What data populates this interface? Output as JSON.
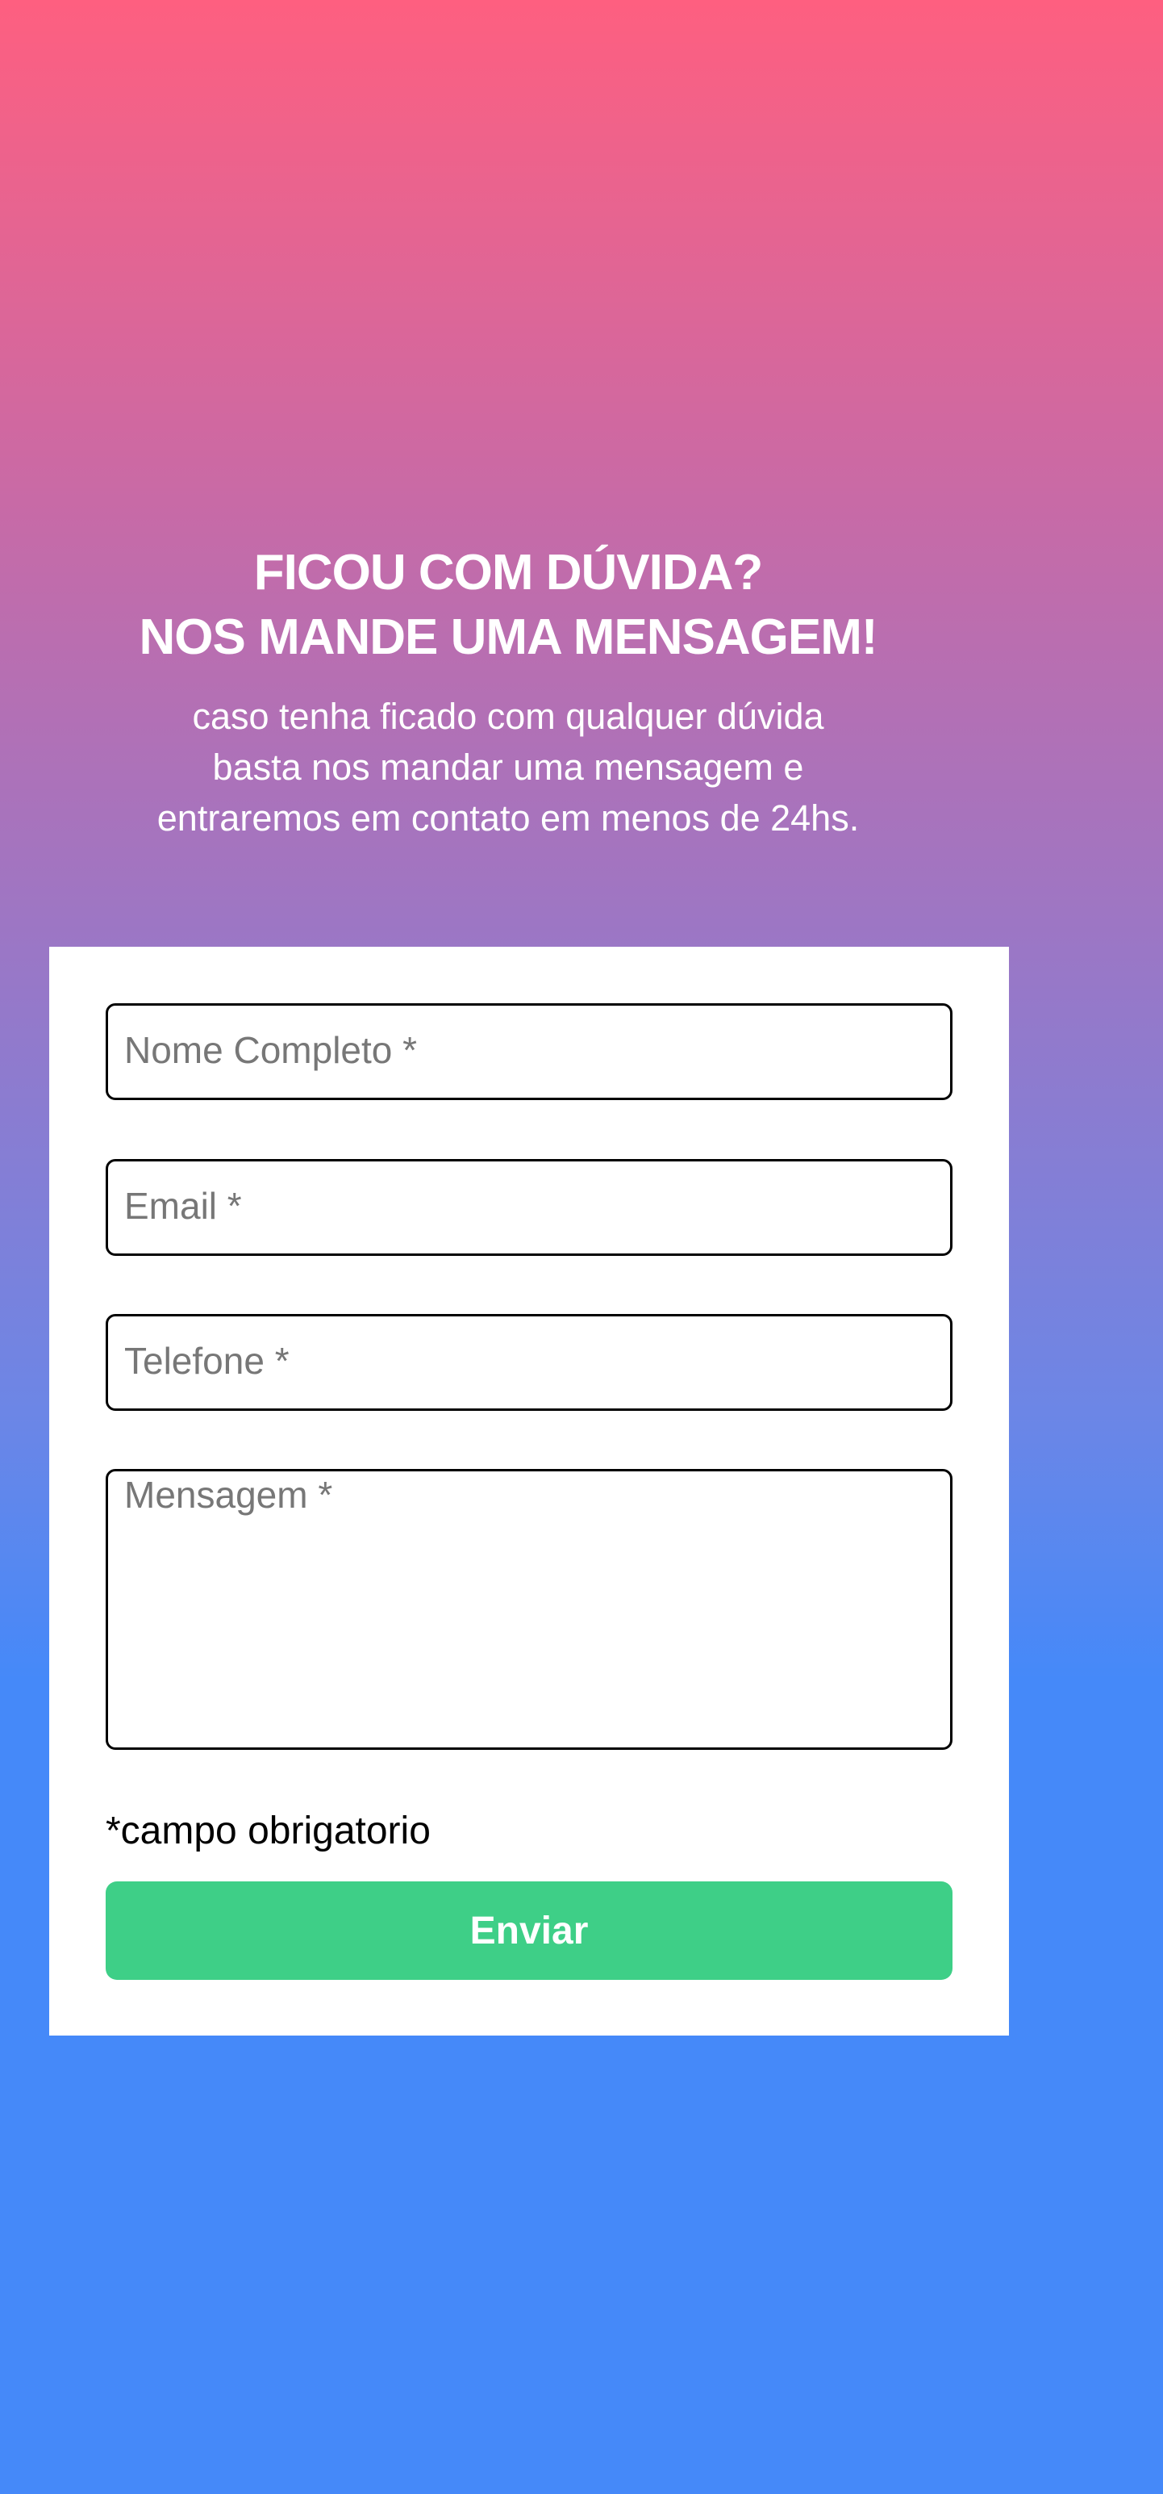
{
  "hero": {
    "title_line1": "FICOU COM DÚVIDA?",
    "title_line2": "NOS MANDE UMA MENSAGEM!",
    "subtitle_line1": "caso tenha ficado com qualquer dúvida",
    "subtitle_line2": "basta nos mandar uma mensagem e",
    "subtitle_line3": "entraremos em contato em menos de 24hs."
  },
  "form": {
    "name_placeholder": "Nome Completo *",
    "email_placeholder": "Email *",
    "phone_placeholder": "Telefone *",
    "message_placeholder": "Mensagem *",
    "required_note": "*campo obrigatorio",
    "submit_label": "Enviar"
  },
  "colors": {
    "gradient_top": "#fe5f80",
    "gradient_bottom": "#4589f9",
    "button": "#3ecf87"
  }
}
